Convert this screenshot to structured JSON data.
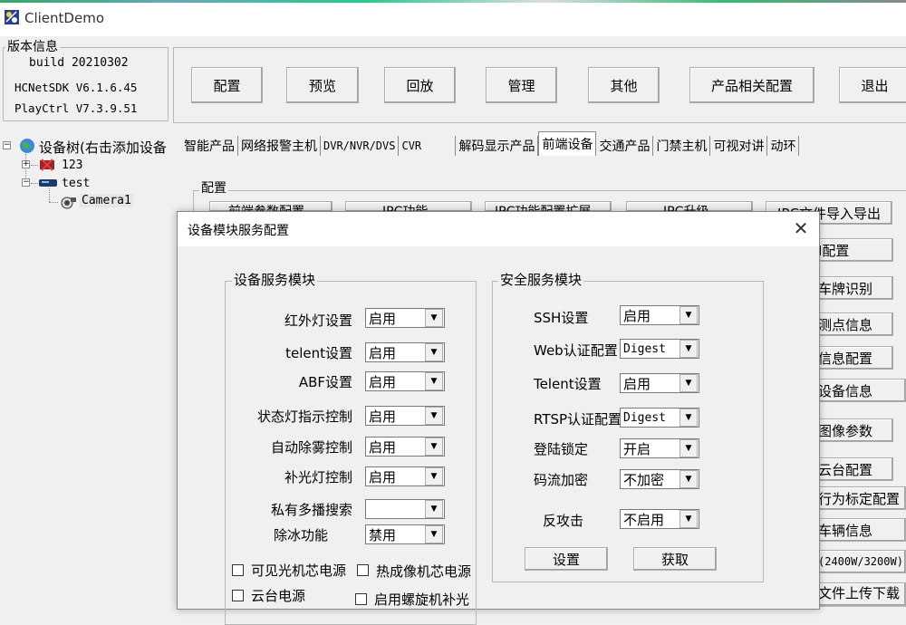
{
  "window": {
    "title": "ClientDemo"
  },
  "version_info": {
    "group_title": "版本信息",
    "build": "build 20210302",
    "sdk": "HCNetSDK V6.1.6.45",
    "playctrl": "PlayCtrl V7.3.9.51"
  },
  "toolbar": {
    "buttons": [
      "配置",
      "预览",
      "回放",
      "管理",
      "其他",
      "产品相关配置",
      "退出"
    ]
  },
  "device_tree": {
    "root": "设备树(右击添加设备",
    "nodes": [
      {
        "label": "123",
        "icon": "disconnected-device-icon"
      },
      {
        "label": "test",
        "icon": "dvr-device-icon"
      }
    ],
    "camera": "Camera1"
  },
  "tabs": [
    "智能产品",
    "网络报警主机",
    "DVR/NVR/DVS",
    "CVR",
    "解码显示产品",
    "前端设备",
    "交通产品",
    "门禁主机",
    "可视对讲",
    "动环"
  ],
  "active_tab": "前端设备",
  "config_group": {
    "title": "配置",
    "partial_buttons_top": [
      "前端参数配置",
      "IPC功能",
      "IPC功能配置扩展",
      "IPC升级"
    ],
    "right_buttons": [
      "IPC文件导入导出",
      "I配置",
      "车牌识别",
      "测点信息",
      "信息配置",
      "设备信息",
      "图像参数",
      "云台配置",
      "行为标定配置",
      "车辆信息",
      "(2400W/3200W)",
      "文件上传下载"
    ]
  },
  "dialog": {
    "title": "设备模块服务配置",
    "device_group": {
      "title": "设备服务模块",
      "rows": [
        {
          "label": "红外灯设置",
          "value": "启用"
        },
        {
          "label": "telent设置",
          "value": "启用"
        },
        {
          "label": "ABF设置",
          "value": "启用"
        },
        {
          "label": "状态灯指示控制",
          "value": "启用"
        },
        {
          "label": "自动除雾控制",
          "value": "启用"
        },
        {
          "label": "补光灯控制",
          "value": "启用"
        },
        {
          "label": "私有多播搜索",
          "value": ""
        },
        {
          "label": "除冰功能",
          "value": "禁用"
        }
      ],
      "checkboxes": [
        "可见光机芯电源",
        "热成像机芯电源",
        "云台电源",
        "启用螺旋机补光"
      ]
    },
    "security_group": {
      "title": "安全服务模块",
      "rows": [
        {
          "label": "SSH设置",
          "value": "启用"
        },
        {
          "label": "Web认证配置",
          "value": "Digest"
        },
        {
          "label": "Telent设置",
          "value": "启用"
        },
        {
          "label": "RTSP认证配置",
          "value": "Digest"
        },
        {
          "label": "登陆锁定",
          "value": "开启"
        },
        {
          "label": "码流加密",
          "value": "不加密"
        },
        {
          "label": "反攻击",
          "value": "不启用"
        }
      ],
      "set_button": "设置",
      "get_button": "获取"
    }
  }
}
